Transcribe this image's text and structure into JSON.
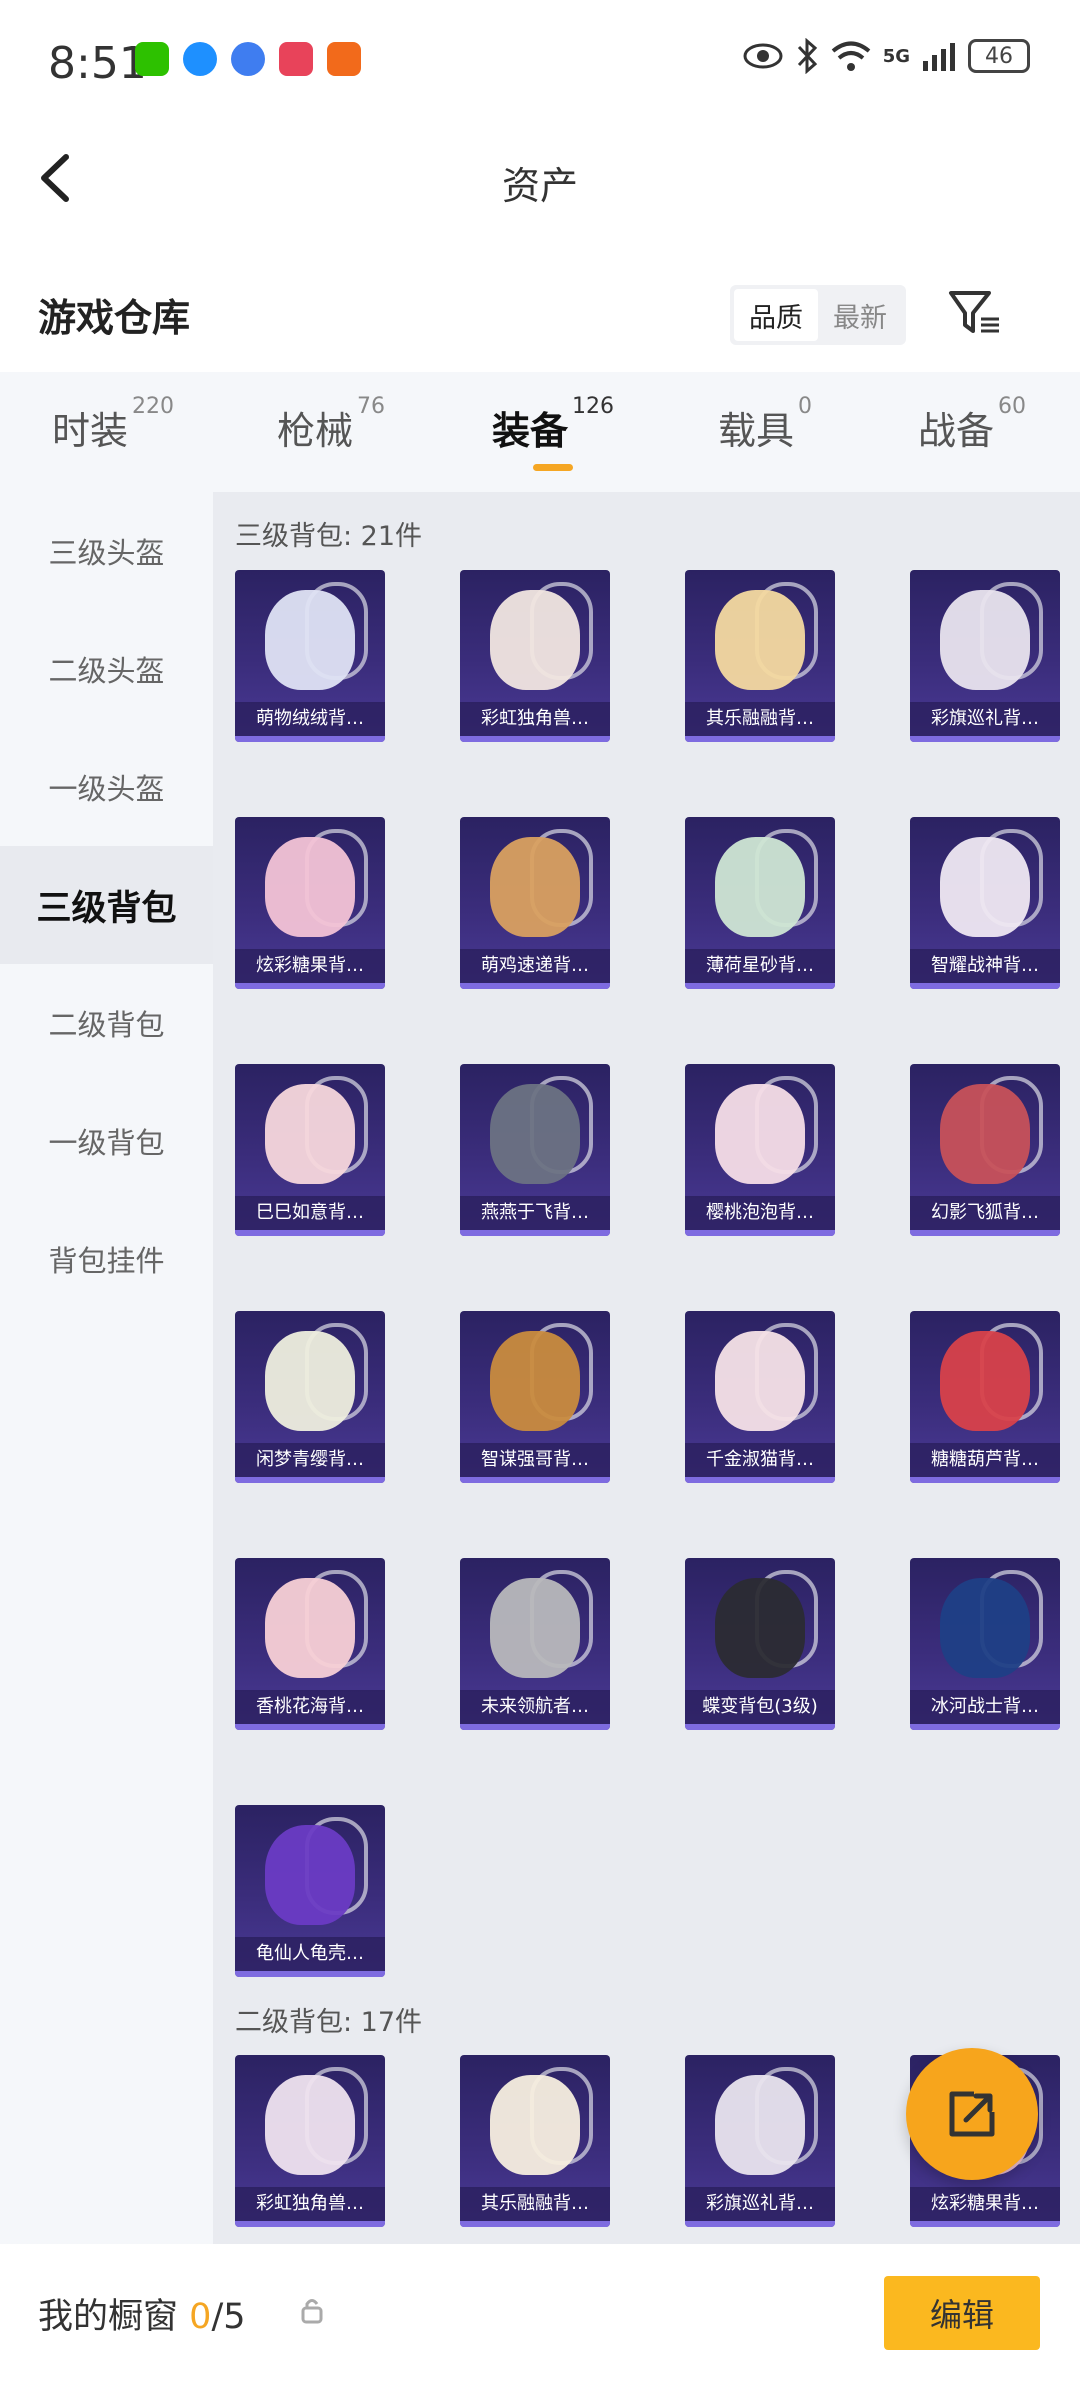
{
  "status": {
    "time": "8:51",
    "network": "5G",
    "battery": "46"
  },
  "header": {
    "title": "资产"
  },
  "section": {
    "title": "游戏仓库",
    "sort_options": [
      "品质",
      "最新"
    ],
    "active_sort": "品质"
  },
  "tabs": [
    {
      "label": "时装",
      "count": "220"
    },
    {
      "label": "枪械",
      "count": "76"
    },
    {
      "label": "装备",
      "count": "126",
      "active": true
    },
    {
      "label": "载具",
      "count": "0"
    },
    {
      "label": "战备",
      "count": "60"
    }
  ],
  "sidebar": {
    "items": [
      "三级头盔",
      "二级头盔",
      "一级头盔",
      "三级背包",
      "二级背包",
      "一级背包",
      "背包挂件"
    ],
    "active": "三级背包"
  },
  "groups": [
    {
      "label": "三级背包: 21件",
      "items": [
        "萌物绒绒背…",
        "彩虹独角兽…",
        "其乐融融背…",
        "彩旗巡礼背…",
        "炫彩糖果背…",
        "萌鸡速递背…",
        "薄荷星砂背…",
        "智耀战神背…",
        "巳巳如意背…",
        "燕燕于飞背…",
        "樱桃泡泡背…",
        "幻影飞狐背…",
        "闲梦青缨背…",
        "智谋强哥背…",
        "千金淑猫背…",
        "糖糖葫芦背…",
        "香桃花海背…",
        "未来领航者…",
        "蝶变背包(3级)",
        "冰河战士背…",
        "龟仙人龟壳…"
      ]
    },
    {
      "label": "二级背包: 17件",
      "items": [
        "彩虹独角兽…",
        "其乐融融背…",
        "彩旗巡礼背…",
        "炫彩糖果背…"
      ]
    }
  ],
  "thumb_colors": [
    "#dfe3f4",
    "#f1e6e0",
    "#f4d9a0",
    "#e9e4ee",
    "#f3c3d6",
    "#d9a060",
    "#cfe6d4",
    "#efe8f2",
    "#f7d7dc",
    "#6b7283",
    "#f6dde7",
    "#c7515a",
    "#eeeede",
    "#c98b3e",
    "#f6e1e7",
    "#d8414a",
    "#f8d0d6",
    "#b8b8bc",
    "#2b2b33",
    "#1f3f86",
    "#6a3bc4",
    "#efe3ef",
    "#f7eedf",
    "#e9e4ee",
    "#f3c3d6"
  ],
  "bottom": {
    "label": "我的橱窗",
    "current": "0",
    "total": "/5",
    "edit": "编辑"
  },
  "colors": {
    "accent": "#f5a623",
    "card_bg": "#2b2262"
  }
}
